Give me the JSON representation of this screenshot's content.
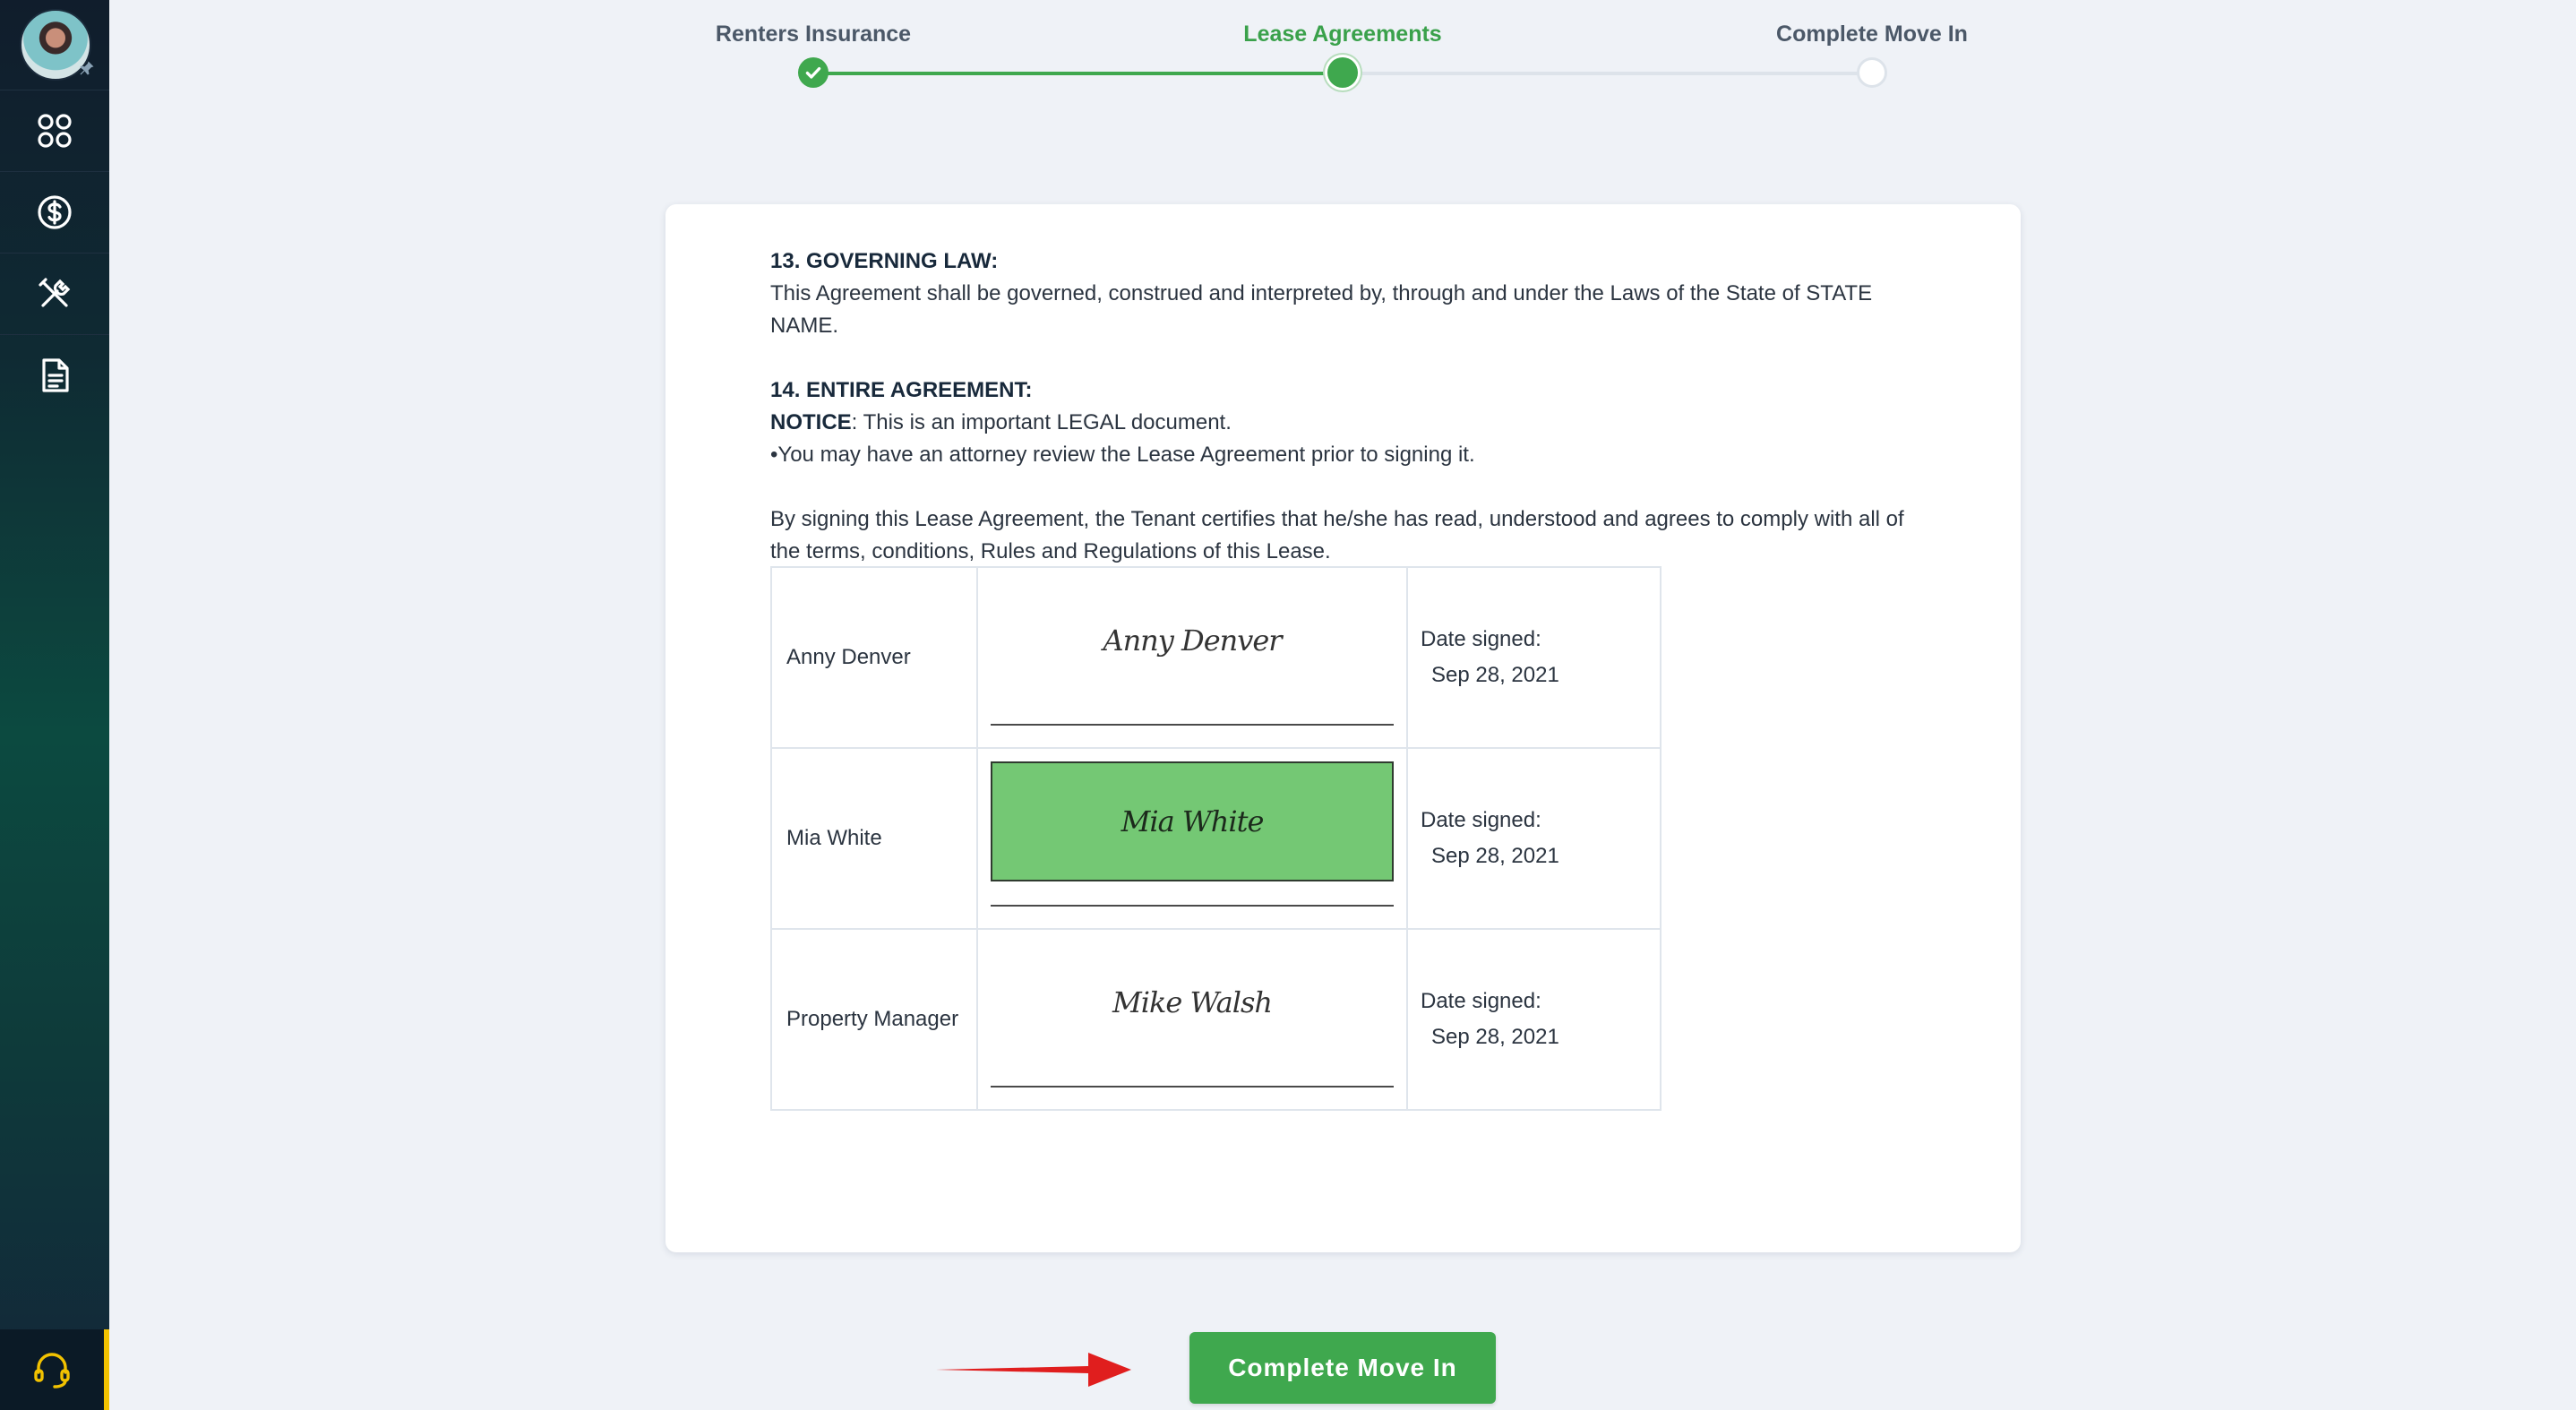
{
  "sidebar": {
    "items": [
      {
        "icon": "apps-grid-icon"
      },
      {
        "icon": "dollar-circle-icon"
      },
      {
        "icon": "tools-icon"
      },
      {
        "icon": "document-icon"
      }
    ],
    "support_icon": "headset-icon",
    "accent": "#f2c200"
  },
  "stepper": {
    "steps": [
      {
        "label": "Renters Insurance",
        "status": "done"
      },
      {
        "label": "Lease Agreements",
        "status": "current"
      },
      {
        "label": "Complete Move In",
        "status": "todo"
      }
    ],
    "accent": "#3fa84e"
  },
  "document": {
    "section13_title": "13. GOVERNING LAW:",
    "section13_body": "This Agreement shall be governed, construed and interpreted by, through and under the Laws of the State of STATE NAME.",
    "section14_title": "14. ENTIRE AGREEMENT:",
    "notice_label": "NOTICE",
    "notice_text": ": This is an important LEGAL document.",
    "attorney_text": "•You may have an attorney review the Lease Agreement prior to signing it.",
    "certify_text": "By signing this Lease Agreement, the Tenant certifies that he/she has read, understood and agrees to comply with all of the terms, conditions, Rules and Regulations of this Lease."
  },
  "signatures": [
    {
      "name": "Anny Denver",
      "signature": "Anny Denver",
      "date_label": "Date signed:",
      "date": "Sep 28, 2021",
      "highlighted": false
    },
    {
      "name": "Mia White",
      "signature": "Mia White",
      "date_label": "Date signed:",
      "date": "Sep 28, 2021",
      "highlighted": true
    },
    {
      "name": "Property Manager",
      "signature": "Mike Walsh",
      "date_label": "Date signed:",
      "date": "Sep 28, 2021",
      "highlighted": false
    }
  ],
  "actions": {
    "complete_label": "Complete Move In"
  },
  "colors": {
    "signature_highlight": "#74c874",
    "arrow": "#e01e1e"
  }
}
